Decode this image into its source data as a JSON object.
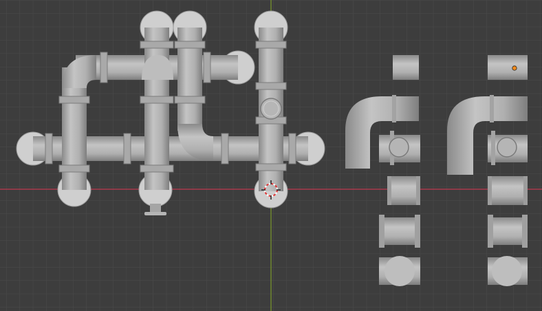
{
  "viewport": {
    "view": "orthographic-top",
    "background_color": "#3d3d3d",
    "grid_color": "#4a4a4a",
    "x_axis_color": "#c0394f",
    "y_axis_color": "#7a9a2a",
    "pipe_color": "#b4b4b4",
    "active_object_origin_color": "#f28b1c",
    "cursor_color": "#e03030"
  },
  "scene": {
    "assembled_pipe_network": "pipe-network",
    "kit_column_1": [
      "straight-pipe-short",
      "elbow-90",
      "tee-joint",
      "coupling",
      "flanged-section",
      "end-cap"
    ],
    "kit_column_2": [
      "straight-pipe-short",
      "elbow-90",
      "tee-joint",
      "coupling",
      "flanged-section",
      "end-cap"
    ]
  }
}
